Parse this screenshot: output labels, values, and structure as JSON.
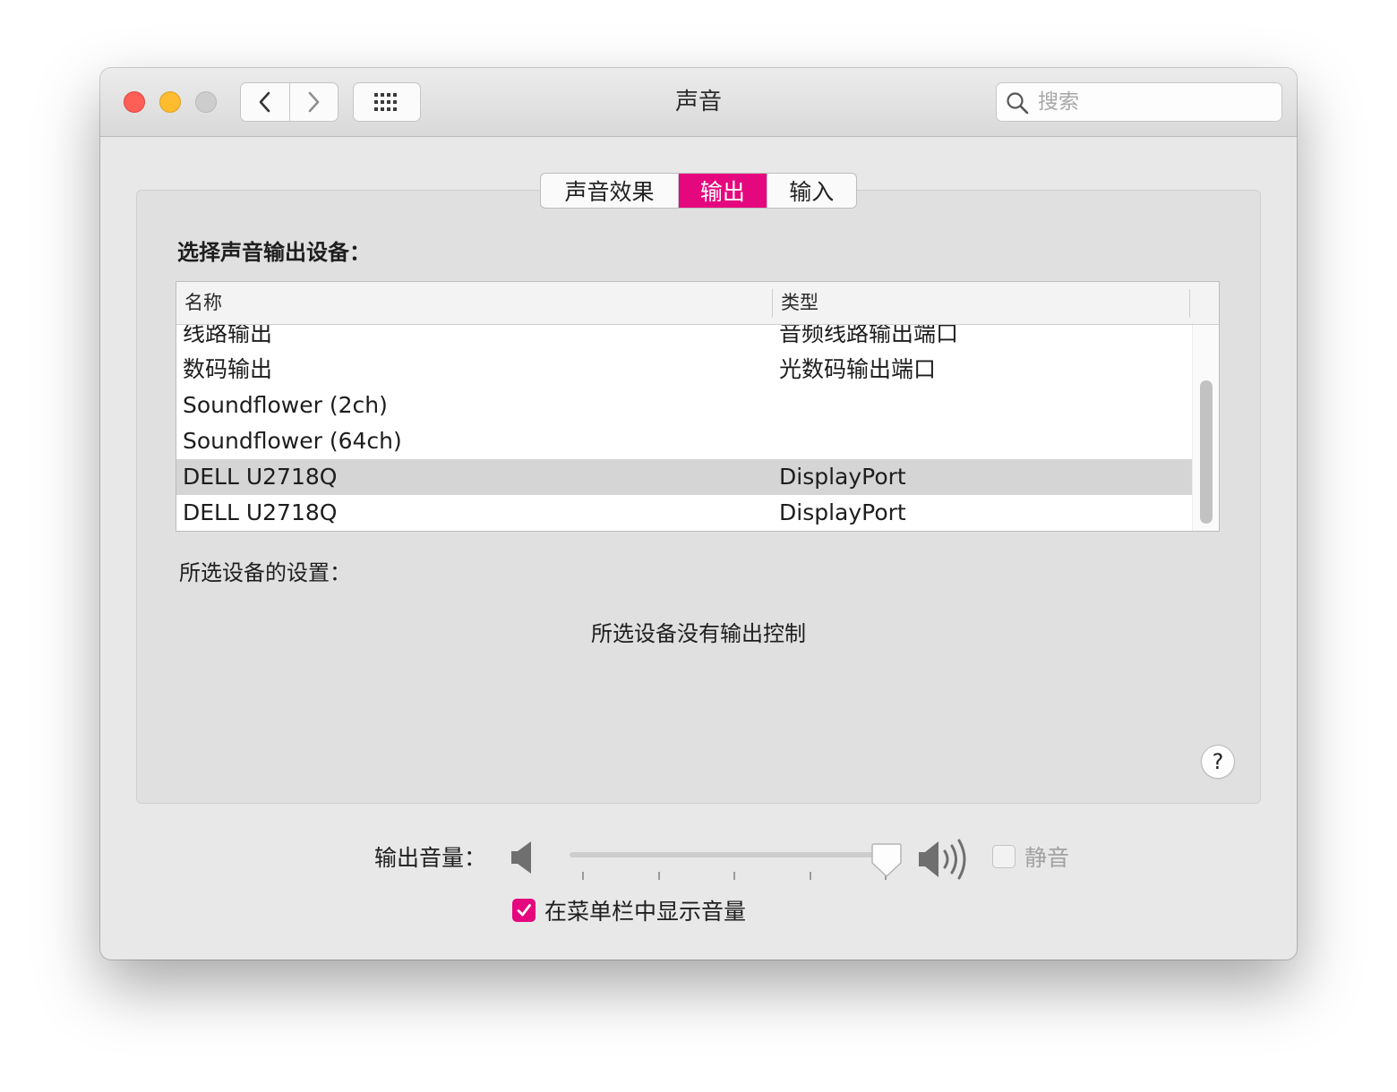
{
  "window": {
    "title": "声音"
  },
  "toolbar": {
    "back_icon": "chevron-left-icon",
    "forward_icon": "chevron-right-icon",
    "show_all_icon": "grid-icon"
  },
  "search": {
    "placeholder": "搜索",
    "icon": "search-icon"
  },
  "tabs": [
    {
      "label": "声音效果",
      "selected": false
    },
    {
      "label": "输出",
      "selected": true
    },
    {
      "label": "输入",
      "selected": false
    }
  ],
  "accent_color": "#e5077e",
  "device_section": {
    "label": "选择声音输出设备："
  },
  "device_table": {
    "columns": [
      "名称",
      "类型"
    ],
    "rows": [
      {
        "name": "线路输出",
        "type": "音频线路输出端口",
        "selected": false
      },
      {
        "name": "数码输出",
        "type": "光数码输出端口",
        "selected": false
      },
      {
        "name": "Soundflower (2ch)",
        "type": "",
        "selected": false
      },
      {
        "name": "Soundflower (64ch)",
        "type": "",
        "selected": false
      },
      {
        "name": "DELL U2718Q",
        "type": "DisplayPort",
        "selected": true
      },
      {
        "name": "DELL U2718Q",
        "type": "DisplayPort",
        "selected": false
      }
    ]
  },
  "settings": {
    "label": "所选设备的设置：",
    "message": "所选设备没有输出控制"
  },
  "help": {
    "label": "?"
  },
  "volume": {
    "label": "输出音量：",
    "level": 0.95,
    "low_icon": "speaker-low-icon",
    "high_icon": "speaker-high-icon",
    "mute_label": "静音",
    "mute_checked": false,
    "mute_enabled": false
  },
  "menubar_option": {
    "label": "在菜单栏中显示音量",
    "checked": true
  }
}
